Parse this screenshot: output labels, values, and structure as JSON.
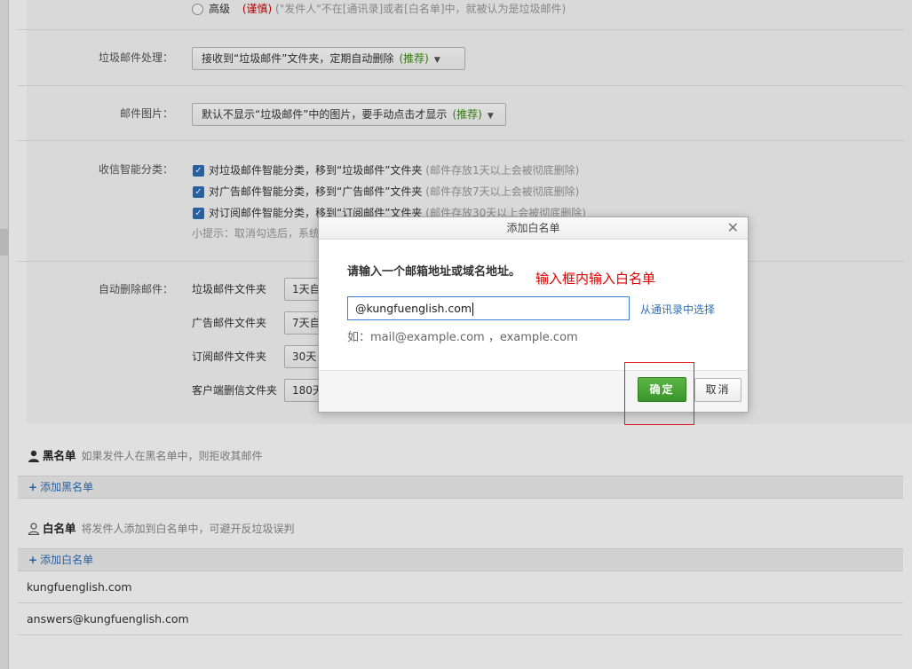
{
  "settings": {
    "advanced": {
      "label": "高级",
      "tag": "(谨慎)",
      "desc": "(\"发件人\"不在[通讯录]或者[白名单]中，就被认为是垃圾邮件)"
    },
    "spam_handling": {
      "label": "垃圾邮件处理：",
      "value": "接收到“垃圾邮件”文件夹，定期自动删除",
      "rec": "(推荐)"
    },
    "mail_images": {
      "label": "邮件图片：",
      "value": "默认不显示“垃圾邮件”中的图片，要手动点击才显示",
      "rec": "(推荐)"
    },
    "smart_sort": {
      "label": "收信智能分类：",
      "items": [
        {
          "text": "对垃圾邮件智能分类，移到“垃圾邮件”文件夹",
          "note": "(邮件存放1天以上会被彻底删除)"
        },
        {
          "text": "对广告邮件智能分类，移到“广告邮件”文件夹",
          "note": "(邮件存放7天以上会被彻底删除)"
        },
        {
          "text": "对订阅邮件智能分类，移到“订阅邮件”文件夹",
          "note": "(邮件存放30天以上会被彻底删除)"
        }
      ],
      "tip": "小提示：取消勾选后，系统"
    },
    "auto_delete": {
      "label": "自动删除邮件：",
      "rows": [
        {
          "folder": "垃圾邮件文件夹",
          "value": "1天自"
        },
        {
          "folder": "广告邮件文件夹",
          "value": "7天自"
        },
        {
          "folder": "订阅邮件文件夹",
          "value": "30天"
        },
        {
          "folder": "客户端删信文件夹",
          "value": "180天"
        }
      ]
    }
  },
  "blacklist": {
    "title": "黑名单",
    "desc": "如果发件人在黑名单中，则拒收其邮件",
    "add": "添加黑名单"
  },
  "whitelist": {
    "title": "白名单",
    "desc": "将发件人添加到白名单中，可避开反垃圾误判",
    "add": "添加白名单",
    "entries": [
      "kungfuenglish.com",
      "answers@kungfuenglish.com"
    ]
  },
  "modal": {
    "title": "添加白名单",
    "prompt": "请输入一个邮箱地址或域名地址。",
    "annotation": "输入框内输入白名单",
    "input_value": "@kungfuenglish.com",
    "pick_link": "从通讯录中选择",
    "example": "如：mail@example.com ，example.com",
    "ok": "确定",
    "cancel": "取消"
  },
  "colors": {
    "accent": "#2e6fb8",
    "ok": "#3a962a",
    "annotation": "#d00000"
  }
}
